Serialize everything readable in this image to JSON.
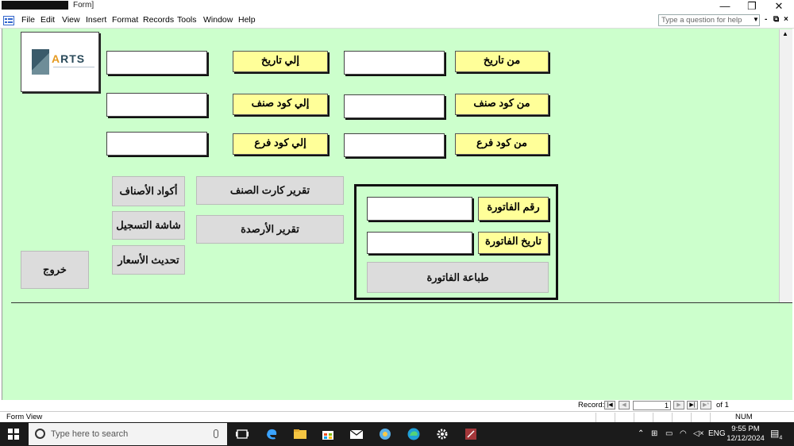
{
  "window": {
    "title": "Form]",
    "controls": {
      "minimize": "—",
      "restore": "❐",
      "close": "✕"
    }
  },
  "menu": {
    "items": [
      "File",
      "Edit",
      "View",
      "Insert",
      "Format",
      "Records",
      "Tools",
      "Window",
      "Help"
    ],
    "help_placeholder": "Type a question for help",
    "mdi": {
      "minimize": "-",
      "restore": "⧉",
      "close": "×"
    }
  },
  "form": {
    "logo_text": "ARTS",
    "filters": {
      "from_date": "من تاريخ",
      "to_date": "إلي تاريخ",
      "from_item": "من كود صنف",
      "to_item": "إلي كود صنف",
      "from_branch": "من كود فرع",
      "to_branch": "إلي كود فرع",
      "from_date_value": "",
      "to_date_value": "",
      "from_item_value": "",
      "to_item_value": "",
      "from_branch_value": "",
      "to_branch_value": ""
    },
    "buttons": {
      "item_codes": "أكواد الأصناف",
      "registration": "شاشة التسجيل",
      "update_prices": "تحديث الأسعار",
      "item_card_report": "تقرير كارت الصنف",
      "balances_report": "تقرير الأرصدة",
      "exit": "خروج"
    },
    "invoice": {
      "number_label": "رقم الفاتورة",
      "date_label": "تاريخ الفاتورة",
      "number_value": "",
      "date_value": "",
      "print_button": "طباعة الفاتورة"
    }
  },
  "record_nav": {
    "label": "Record:",
    "current": "1",
    "of_label": "of",
    "total": "1"
  },
  "status": {
    "view": "Form View",
    "num": "NUM"
  },
  "taskbar": {
    "search_placeholder": "Type here to search",
    "lang": "ENG",
    "time": "9:55 PM",
    "date": "12/12/2024",
    "notifications": "4"
  }
}
